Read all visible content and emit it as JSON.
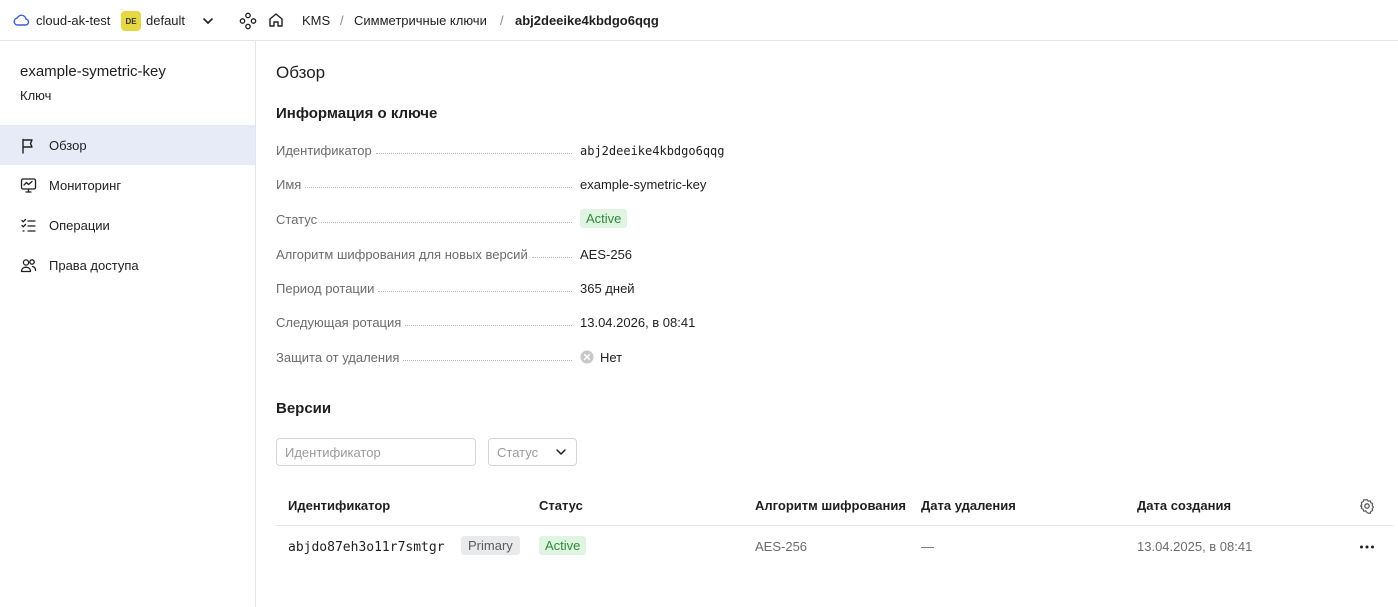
{
  "header": {
    "cloud_name": "cloud-ak-test",
    "folder_badge": "DE",
    "folder_name": "default",
    "breadcrumbs": [
      "KMS",
      "Симметричные ключи",
      "abj2deeike4kbdgo6qqg"
    ],
    "separator": "/"
  },
  "sidebar": {
    "resource_title": "example-symetric-key",
    "resource_subtitle": "Ключ",
    "items": [
      {
        "label": "Обзор",
        "icon": "flag-icon",
        "active": true
      },
      {
        "label": "Мониторинг",
        "icon": "monitor-icon"
      },
      {
        "label": "Операции",
        "icon": "list-check-icon"
      },
      {
        "label": "Права доступа",
        "icon": "persons-icon"
      }
    ]
  },
  "main": {
    "title": "Обзор",
    "info_section_title": "Информация о ключе",
    "properties": [
      {
        "label": "Идентификатор",
        "value": "abj2deeike4kbdgo6qqg"
      },
      {
        "label": "Имя",
        "value": "example-symetric-key"
      },
      {
        "label": "Статус",
        "value": "Active"
      },
      {
        "label": "Алгоритм шифрования для новых версий",
        "value": "AES-256"
      },
      {
        "label": "Период ротации",
        "value": "365 дней"
      },
      {
        "label": "Следующая ротация",
        "value": "13.04.2026, в 08:41"
      },
      {
        "label": "Защита от удаления",
        "value": "Нет"
      }
    ],
    "versions_title": "Версии",
    "filter_id_placeholder": "Идентификатор",
    "filter_status_placeholder": "Статус",
    "table": {
      "columns": [
        "Идентификатор",
        "Статус",
        "Алгоритм шифрования",
        "Дата удаления",
        "Дата создания"
      ],
      "rows": [
        {
          "id": "abjdo87eh3o11r7smtgr",
          "tag": "Primary",
          "status": "Active",
          "algorithm": "AES-256",
          "deleted": "—",
          "created": "13.04.2025, в 08:41"
        }
      ]
    }
  },
  "colors": {
    "active_bg": "#dff4e1",
    "active_text": "#2f8a3b",
    "nav_active_bg": "#e7ebf8",
    "folder_badge_bg": "#e5d844"
  }
}
